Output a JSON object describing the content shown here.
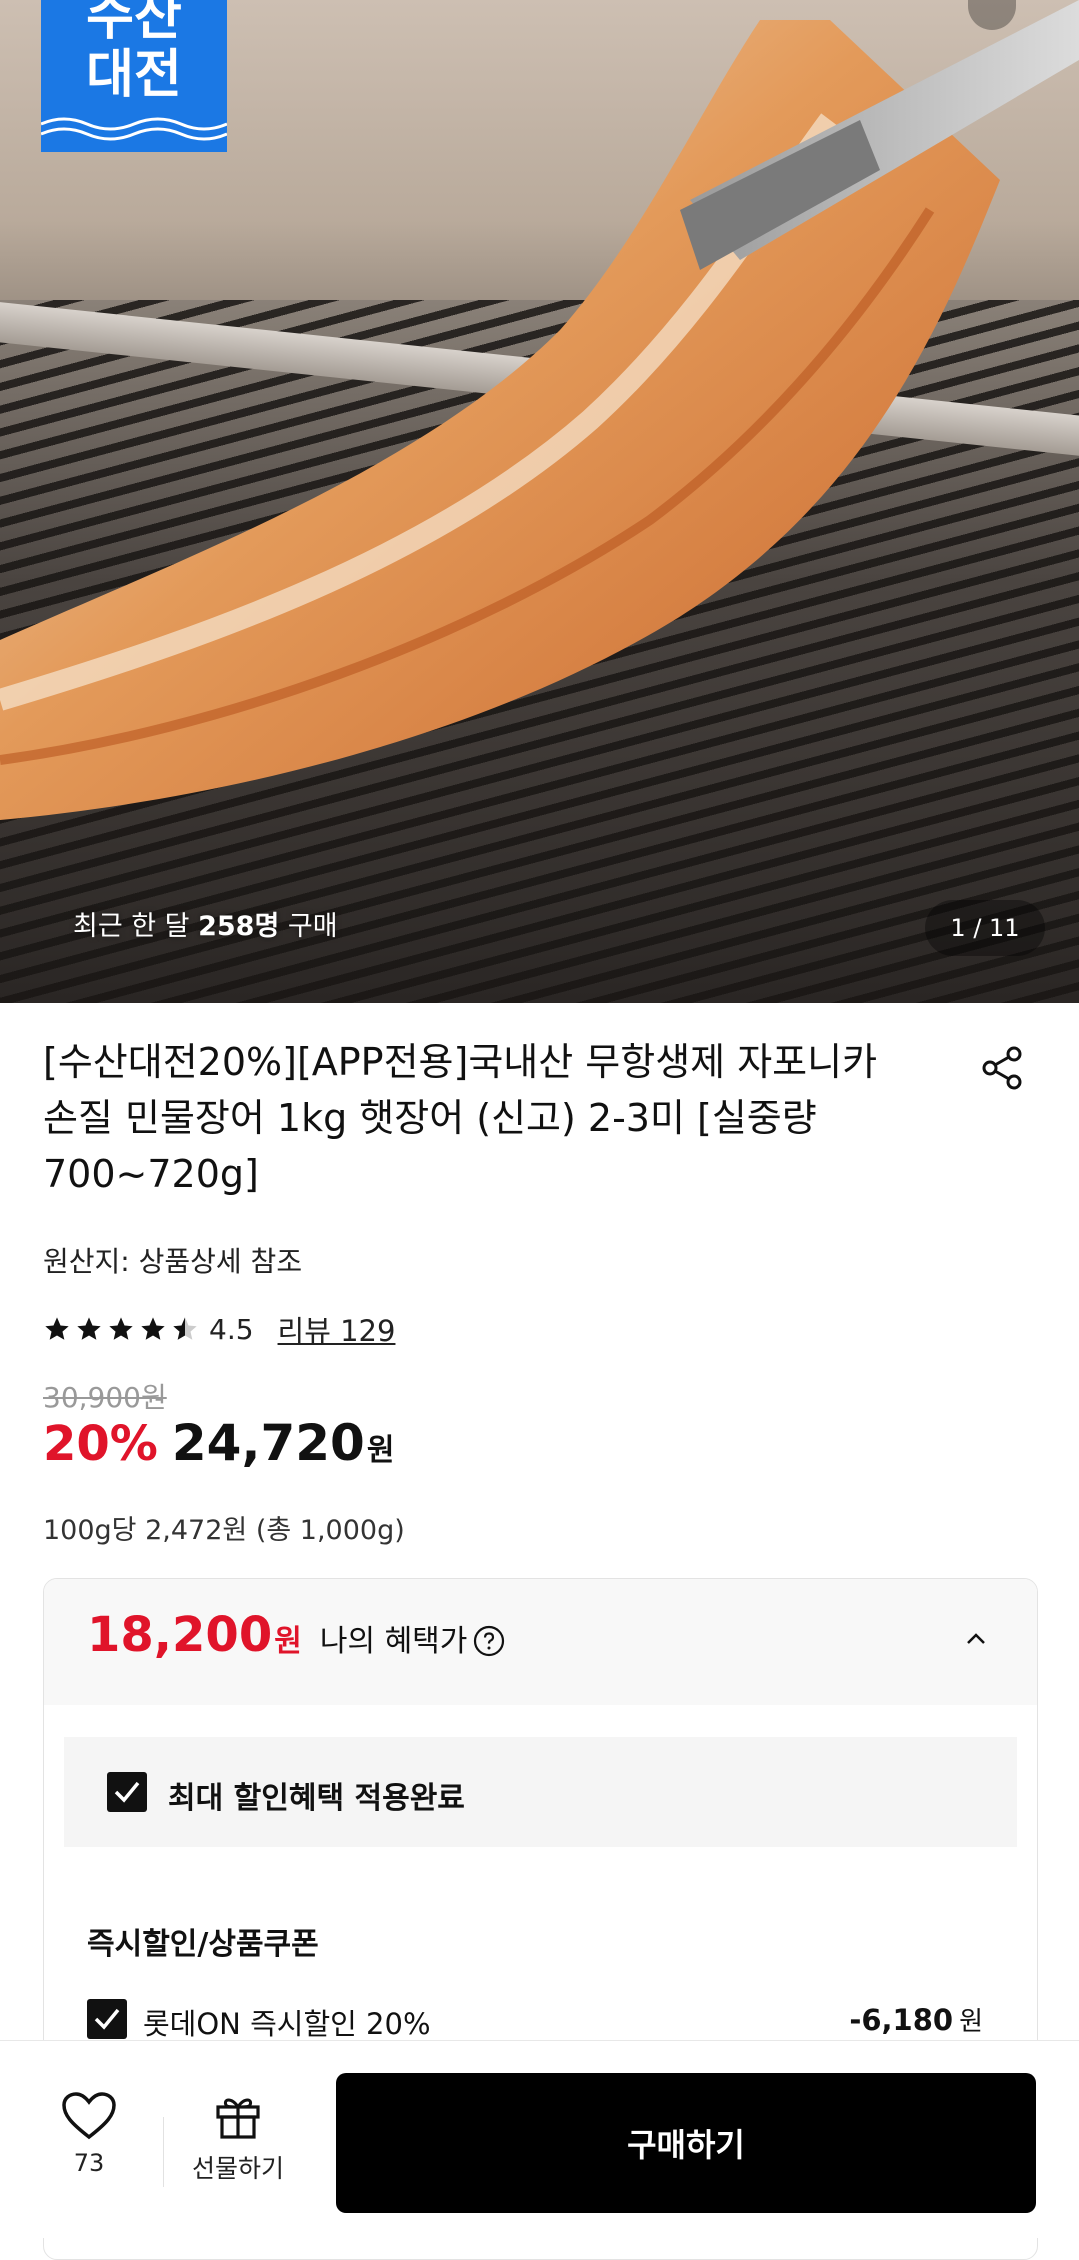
{
  "hero": {
    "brand_badge": "수산\n대전",
    "purchase_note_prefix": "최근 한 달 ",
    "purchase_note_count": "258명",
    "purchase_note_suffix": " 구매",
    "page_counter": "1 / 11"
  },
  "product": {
    "title": "[수산대전20%][APP전용]국내산 무항생제 자포니카 손질 민물장어 1kg 햇장어 (신고) 2-3미 [실중량 700~720g]",
    "origin": "원산지: 상품상세 참조",
    "rating": "4.5",
    "rating_value": 4.5,
    "review_link": "리뷰 129",
    "original_price": "30,900원",
    "discount_rate": "20%",
    "sale_price": "24,720",
    "currency": "원",
    "unit_price": "100g당 2,472원 (총 1,000g)"
  },
  "benefit": {
    "price": "18,200",
    "currency": "원",
    "label": "나의 혜택가",
    "max_applied": "최대 할인혜택 적용완료",
    "section_title": "즉시할인/상품쿠폰",
    "items": [
      {
        "label": "롯데ON 즉시할인 20%",
        "amount": "-6,180",
        "unit": "원"
      }
    ]
  },
  "bottom_bar": {
    "like_count": "73",
    "gift_label": "선물하기",
    "buy_label": "구매하기"
  },
  "colors": {
    "accent_red": "#e0142a",
    "brand_blue": "#1b78e4",
    "buy_button": "#000000"
  }
}
